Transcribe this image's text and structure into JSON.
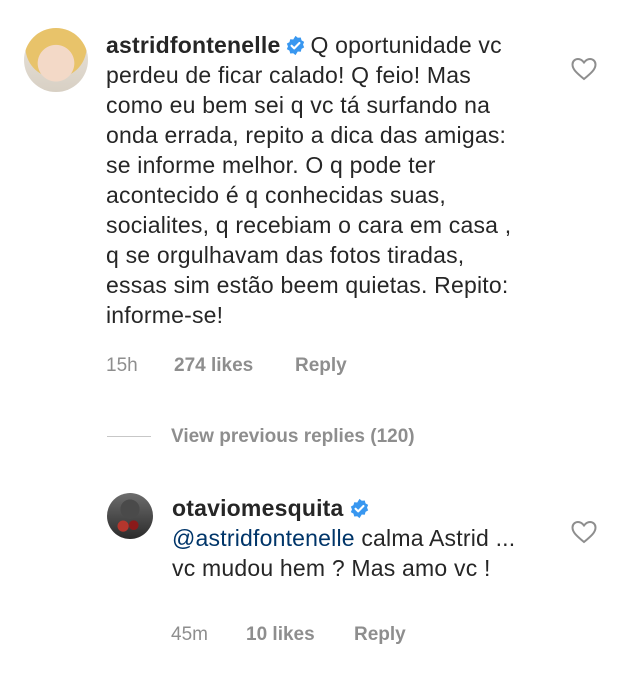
{
  "comment": {
    "username": "astridfontenelle",
    "verified": true,
    "text": "Q oportunidade vc perdeu de ficar calado!  Q feio! Mas como eu bem sei q vc tá surfando na onda errada, repito a dica das amigas: se informe melhor. O q pode ter acontecido é q conhecidas suas, socialites, q recebiam o cara em casa , q se orgulhavam das fotos tiradas, essas sim estão beem quietas. Repito: informe-se!",
    "time": "15h",
    "likes": "274 likes",
    "reply_label": "Reply",
    "like_icon": "heart-outline-icon"
  },
  "view_previous": "View previous replies (120)",
  "reply": {
    "username": "otaviomesquita",
    "verified": true,
    "mention": "@astridfontenelle",
    "text": " calma Astrid ... vc mudou hem ? Mas amo vc !",
    "time": "45m",
    "likes": "10 likes",
    "reply_label": "Reply",
    "like_icon": "heart-outline-icon"
  },
  "colors": {
    "verified_badge": "#3897f0",
    "meta_text": "#8e8e8e",
    "mention": "#003569"
  }
}
